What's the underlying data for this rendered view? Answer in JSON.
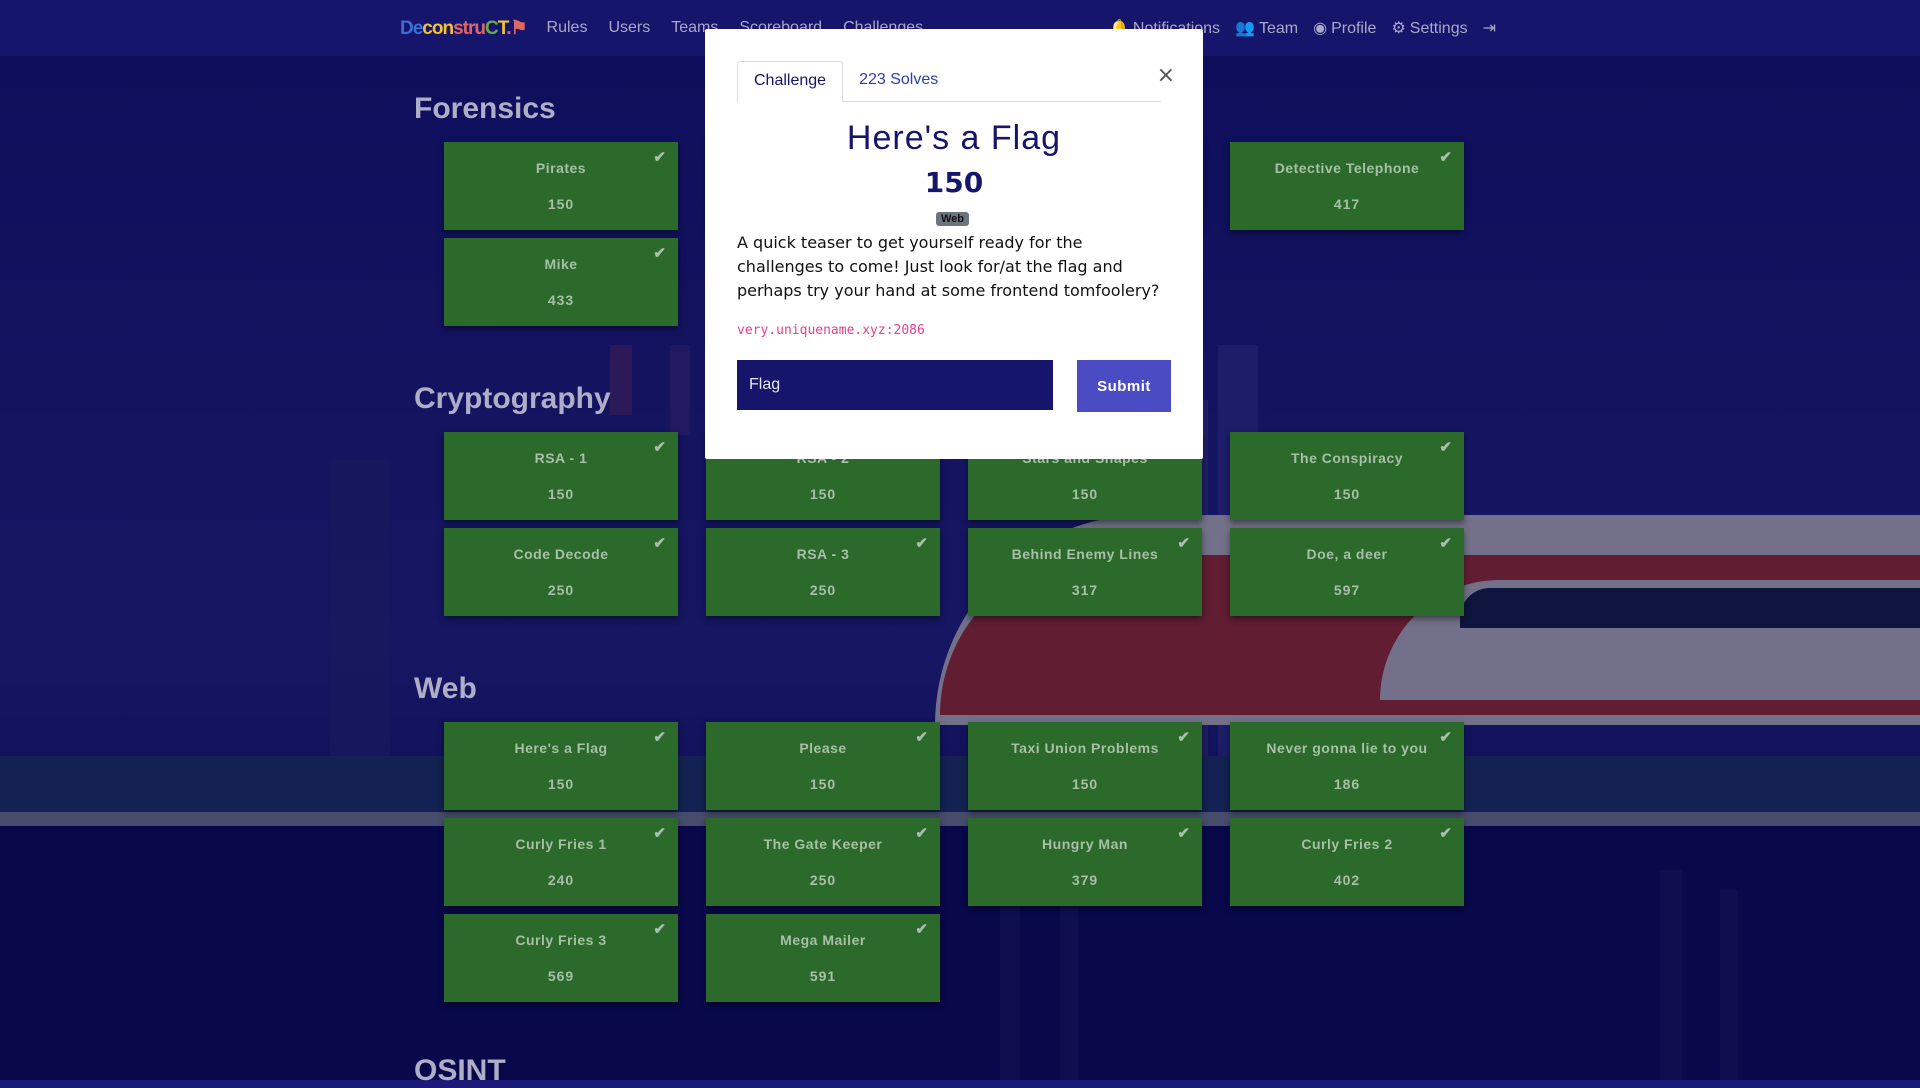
{
  "nav": {
    "brand": [
      "De",
      "con",
      "stru",
      "C",
      "T",
      ".⚑"
    ],
    "links": [
      "Rules",
      "Users",
      "Teams",
      "Scoreboard",
      "Challenges"
    ],
    "right": {
      "notifications": "Notifications",
      "team": "Team",
      "profile": "Profile",
      "settings": "Settings"
    }
  },
  "categories": [
    {
      "title": "Forensics",
      "cards": [
        {
          "name": "Pirates",
          "points": "150",
          "solved": true
        },
        {
          "name": "",
          "points": "",
          "solved": true
        },
        {
          "name": "",
          "points": "",
          "solved": true
        },
        {
          "name": "Detective Telephone",
          "points": "417",
          "solved": true
        },
        {
          "name": "Mike",
          "points": "433",
          "solved": true
        }
      ]
    },
    {
      "title": "Cryptography",
      "cards": [
        {
          "name": "RSA - 1",
          "points": "150",
          "solved": true
        },
        {
          "name": "RSA - 2",
          "points": "150",
          "solved": true
        },
        {
          "name": "Stars and Shapes",
          "points": "150",
          "solved": true
        },
        {
          "name": "The Conspiracy",
          "points": "150",
          "solved": true
        },
        {
          "name": "Code Decode",
          "points": "250",
          "solved": true
        },
        {
          "name": "RSA - 3",
          "points": "250",
          "solved": true
        },
        {
          "name": "Behind Enemy Lines",
          "points": "317",
          "solved": true
        },
        {
          "name": "Doe, a deer",
          "points": "597",
          "solved": true
        }
      ]
    },
    {
      "title": "Web",
      "cards": [
        {
          "name": "Here's a Flag",
          "points": "150",
          "solved": true
        },
        {
          "name": "Please",
          "points": "150",
          "solved": true
        },
        {
          "name": "Taxi Union Problems",
          "points": "150",
          "solved": true
        },
        {
          "name": "Never gonna lie to you",
          "points": "186",
          "solved": true
        },
        {
          "name": "Curly Fries 1",
          "points": "240",
          "solved": true
        },
        {
          "name": "The Gate Keeper",
          "points": "250",
          "solved": true
        },
        {
          "name": "Hungry Man",
          "points": "379",
          "solved": true
        },
        {
          "name": "Curly Fries 2",
          "points": "402",
          "solved": true
        },
        {
          "name": "Curly Fries 3",
          "points": "569",
          "solved": true
        },
        {
          "name": "Mega Mailer",
          "points": "591",
          "solved": true
        }
      ]
    },
    {
      "title": "OSINT",
      "cards": []
    }
  ],
  "modal": {
    "tab_challenge": "Challenge",
    "tab_solves": "223 Solves",
    "close": "×",
    "title": "Here's a Flag",
    "points": "150",
    "tag": "Web",
    "description": "A quick teaser to get yourself ready for the challenges to come! Just look for/at the flag and perhaps try your hand at some frontend tomfoolery?",
    "link": "very.uniquename.xyz:2086",
    "flag_placeholder": "Flag",
    "submit": "Submit"
  },
  "colors": {
    "navbar": "#15156c",
    "card_solved": "#2b6a2b",
    "accent": "#4b4bc4",
    "link": "#e83e8c"
  }
}
